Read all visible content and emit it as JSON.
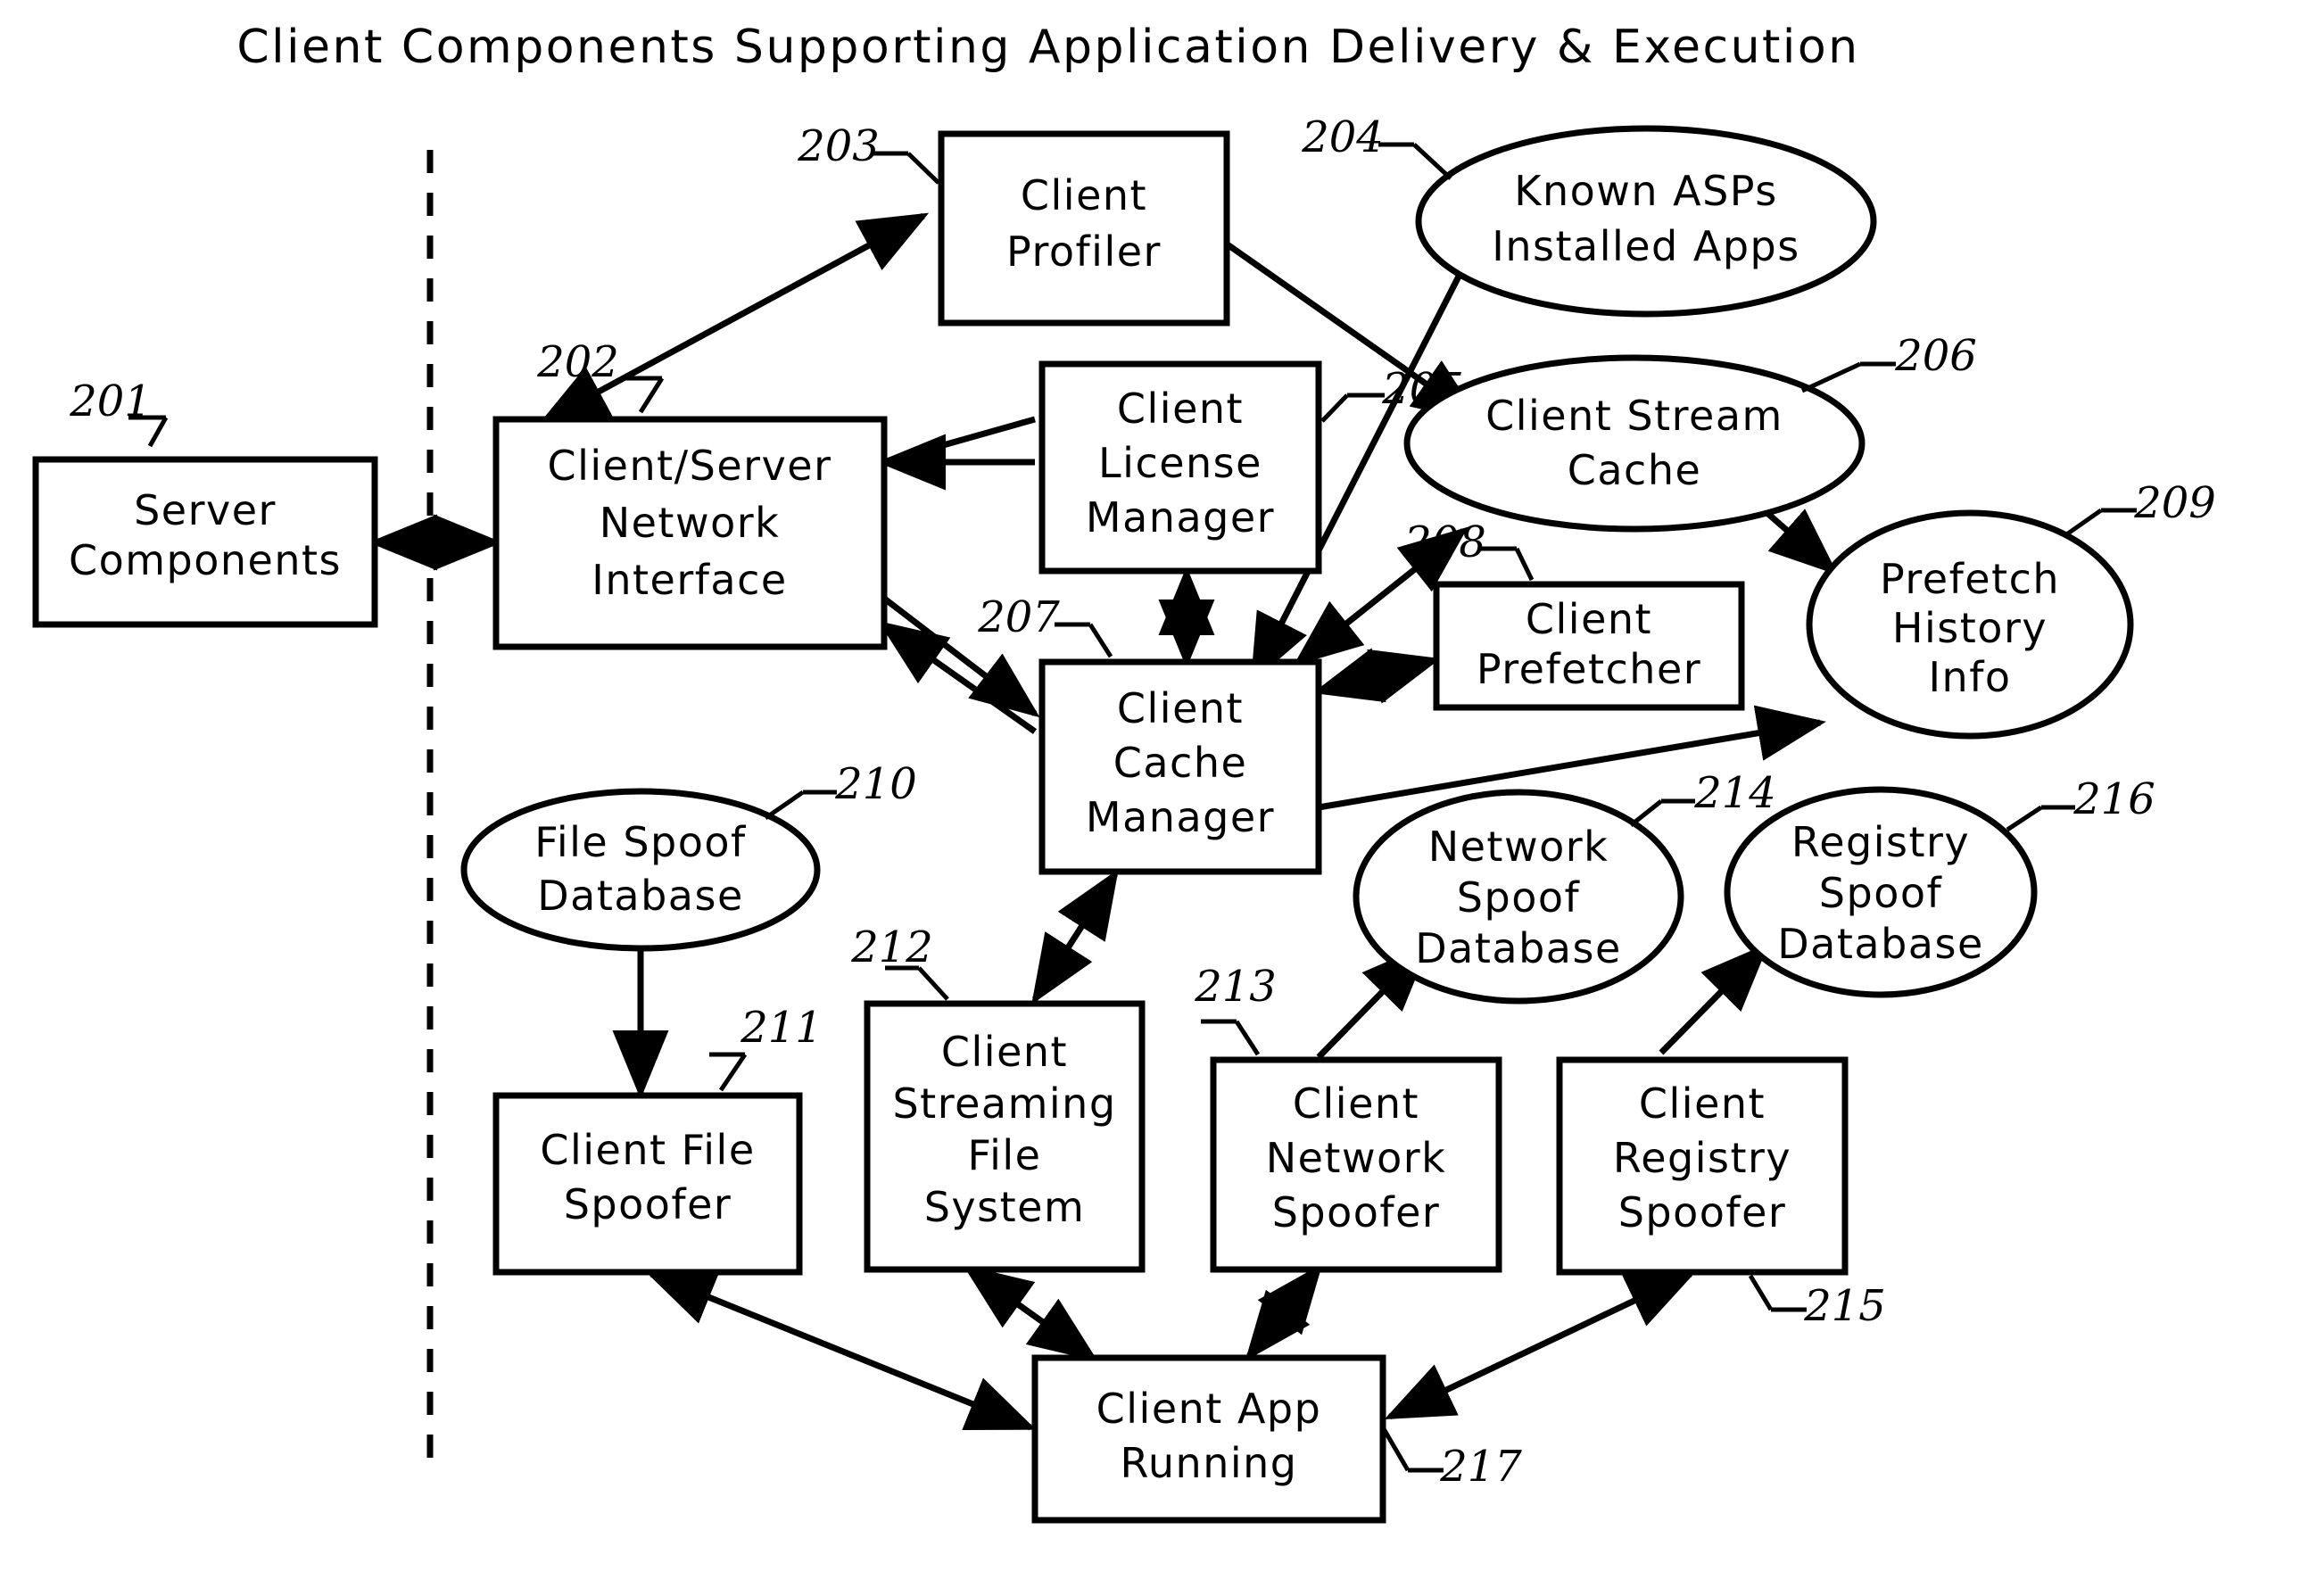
{
  "figure": {
    "title": "Client Components Supporting Application Delivery & Execution",
    "colors": {
      "stroke": "#000000",
      "background": "#ffffff"
    }
  },
  "nodes": {
    "server_components": {
      "ref": "201",
      "label_line1": "Server",
      "label_line2": "Components",
      "shape": "rectangle"
    },
    "client_server_network_interface": {
      "ref": "202",
      "label_line1": "Client/Server",
      "label_line2": "Network",
      "label_line3": "Interface",
      "shape": "rectangle"
    },
    "client_profiler": {
      "ref": "203",
      "label_line1": "Client",
      "label_line2": "Profiler",
      "shape": "rectangle"
    },
    "known_asps_installed_apps": {
      "ref": "204",
      "label_line1": "Known ASPs",
      "label_line2": "Installed Apps",
      "shape": "ellipse"
    },
    "client_license_manager": {
      "ref": "205",
      "label_line1": "Client",
      "label_line2": "License",
      "label_line3": "Manager",
      "shape": "rectangle"
    },
    "client_stream_cache": {
      "ref": "206",
      "label_line1": "Client Stream",
      "label_line2": "Cache",
      "shape": "ellipse"
    },
    "client_cache_manager": {
      "ref": "207",
      "label_line1": "Client",
      "label_line2": "Cache",
      "label_line3": "Manager",
      "shape": "rectangle"
    },
    "client_prefetcher": {
      "ref": "208",
      "label_line1": "Client",
      "label_line2": "Prefetcher",
      "shape": "rectangle"
    },
    "prefetch_history_info": {
      "ref": "209",
      "label_line1": "Prefetch",
      "label_line2": "History",
      "label_line3": "Info",
      "shape": "ellipse"
    },
    "file_spoof_database": {
      "ref": "210",
      "label_line1": "File Spoof",
      "label_line2": "Database",
      "shape": "ellipse"
    },
    "client_file_spoofer": {
      "ref": "211",
      "label_line1": "Client File",
      "label_line2": "Spoofer",
      "shape": "rectangle"
    },
    "client_streaming_file_system": {
      "ref": "212",
      "label_line1": "Client",
      "label_line2": "Streaming",
      "label_line3": "File",
      "label_line4": "System",
      "shape": "rectangle"
    },
    "client_network_spoofer": {
      "ref": "213",
      "label_line1": "Client",
      "label_line2": "Network",
      "label_line3": "Spoofer",
      "shape": "rectangle"
    },
    "network_spoof_database": {
      "ref": "214",
      "label_line1": "Network",
      "label_line2": "Spoof",
      "label_line3": "Database",
      "shape": "ellipse"
    },
    "client_registry_spoofer": {
      "ref": "215",
      "label_line1": "Client",
      "label_line2": "Registry",
      "label_line3": "Spoofer",
      "shape": "rectangle"
    },
    "registry_spoof_database": {
      "ref": "216",
      "label_line1": "Registry",
      "label_line2": "Spoof",
      "label_line3": "Database",
      "shape": "ellipse"
    },
    "client_app_running": {
      "ref": "217",
      "label_line1": "Client App",
      "label_line2": "Running",
      "shape": "rectangle"
    }
  },
  "divider": {
    "name": "client-server-boundary",
    "style": "dashed-vertical"
  }
}
